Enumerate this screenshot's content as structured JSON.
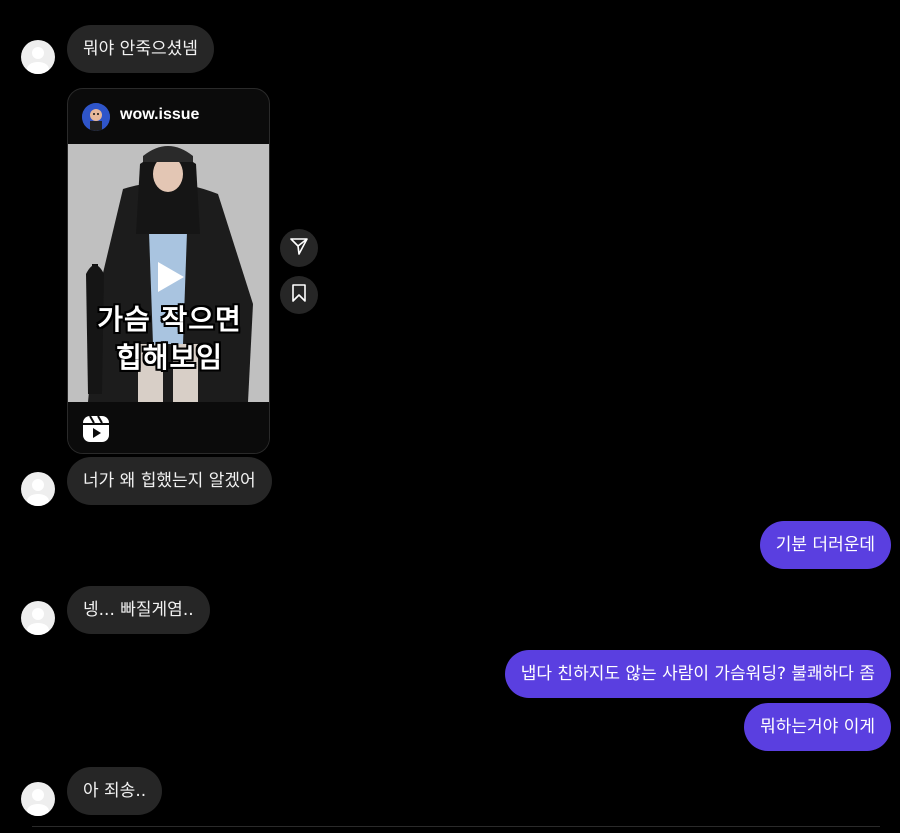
{
  "messages": {
    "m1": "뭐야 안죽으셨넴",
    "m2": "너가 왜 힙했는지 알겠어",
    "m3": "기분 더러운데",
    "m4": "넹... 빠질게염..",
    "m5": "냅다 친하지도 않는 사람이 가슴워딩? 불쾌하다 좀",
    "m6": "뭐하는거야 이게",
    "m7": "아 죄송.."
  },
  "shared_post": {
    "username": "wow.issue",
    "overlay_line1": "가슴 작으면",
    "overlay_line2": "힙해보임"
  },
  "icons": {
    "send": "paper-plane-icon",
    "save": "bookmark-icon",
    "reels": "reels-icon",
    "play": "play-icon"
  },
  "colors": {
    "background": "#000000",
    "incoming_bubble": "#262626",
    "outgoing_bubble": "#5a3fe0"
  }
}
